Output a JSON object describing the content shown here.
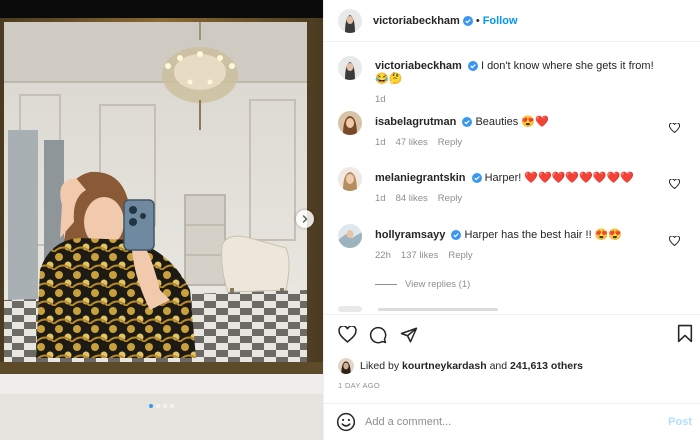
{
  "media": {
    "dots_total": 4,
    "dots_active": 0,
    "next_icon": "chevron-right-icon"
  },
  "header": {
    "username": "victoriabeckham",
    "separator": "•",
    "follow_label": "Follow"
  },
  "comments": [
    {
      "username": "victoriabeckham",
      "text": "I don't know where she gets it from! 😂🤔",
      "time": "1d",
      "likes": "",
      "reply": "",
      "caption": true
    },
    {
      "username": "isabelagrutman",
      "text": "Beauties 😍❤️",
      "time": "1d",
      "likes": "47 likes",
      "reply": "Reply"
    },
    {
      "username": "melaniegrantskin",
      "text": "Harper! ❤️❤️❤️❤️❤️❤️❤️❤️",
      "time": "1d",
      "likes": "84 likes",
      "reply": "Reply"
    },
    {
      "username": "hollyramsayy",
      "text": "Harper has the best hair !! 😍😍",
      "time": "22h",
      "likes": "137 likes",
      "reply": "Reply"
    }
  ],
  "view_replies_label": "View replies (1)",
  "actions": {
    "icons": [
      "heart-icon",
      "comment-icon",
      "share-icon",
      "bookmark-icon"
    ]
  },
  "likes": {
    "prefix": "Liked by",
    "user": "kourtneykardash",
    "joiner": "and",
    "others": "241,613 others"
  },
  "date": "1 DAY AGO",
  "add_comment": {
    "placeholder": "Add a comment...",
    "post_label": "Post"
  },
  "colors": {
    "link_blue": "#0095f6",
    "verified_blue": "#3897f0",
    "muted": "#8e8e8e",
    "post_disabled": "#b2dffc"
  }
}
